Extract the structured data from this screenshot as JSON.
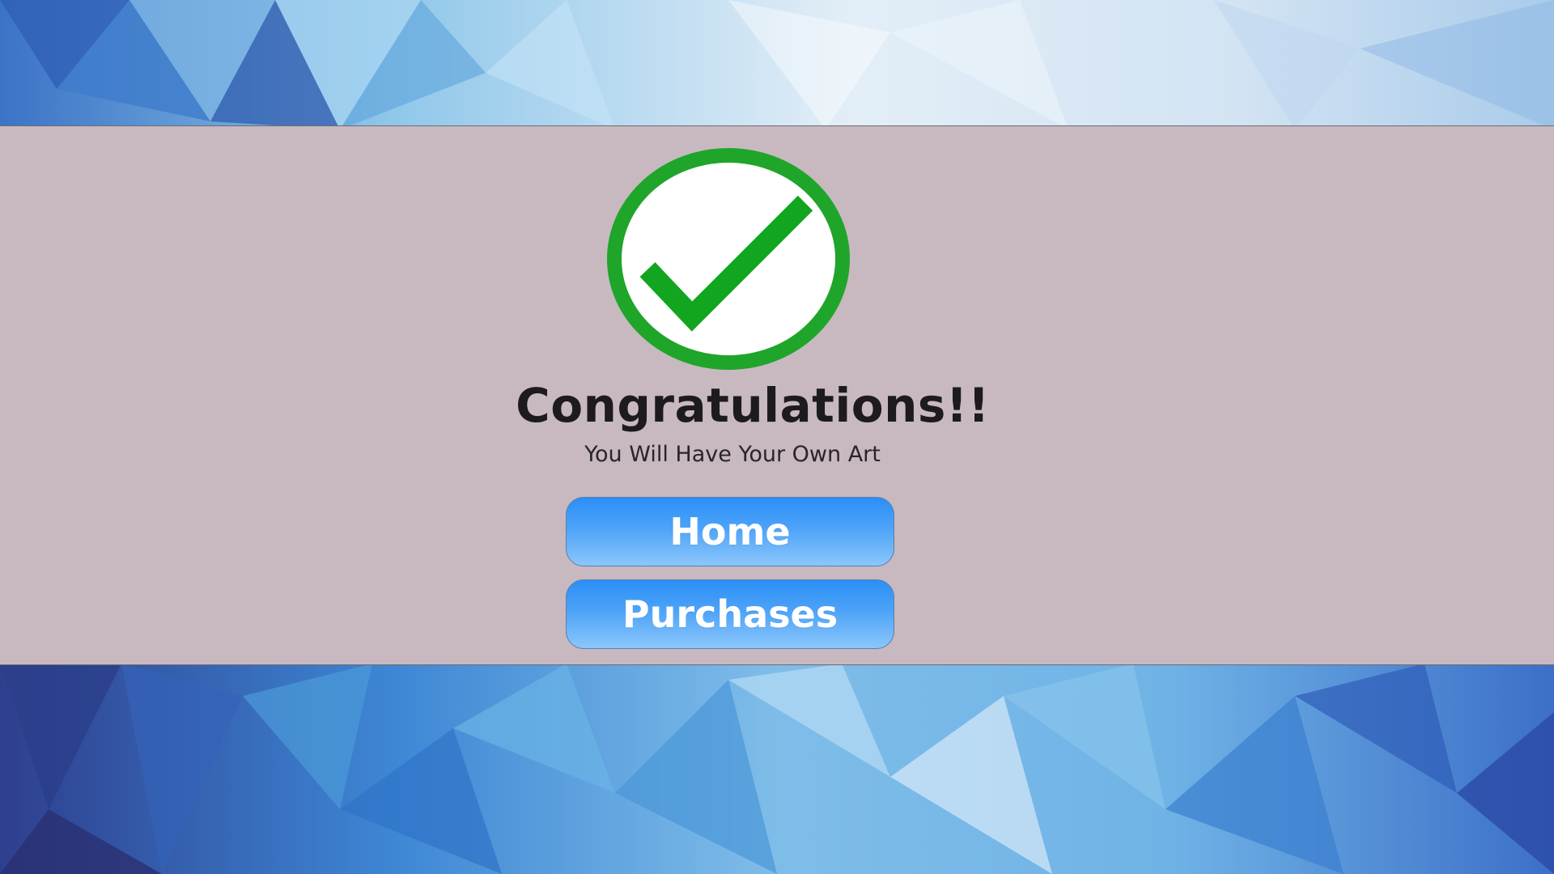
{
  "confirmation": {
    "title": "Congratulations!!",
    "subtitle": "You Will Have Your Own Art",
    "icon": "check-circle-icon"
  },
  "actions": {
    "home_label": "Home",
    "purchases_label": "Purchases"
  },
  "colors": {
    "panel": "#c8b9c0",
    "check_ring": "#1fa52a",
    "check_mark": "#12a51f",
    "button_top": "#2b8ff6",
    "button_bottom": "#8cc6fb",
    "background": "#3f7fd0"
  }
}
